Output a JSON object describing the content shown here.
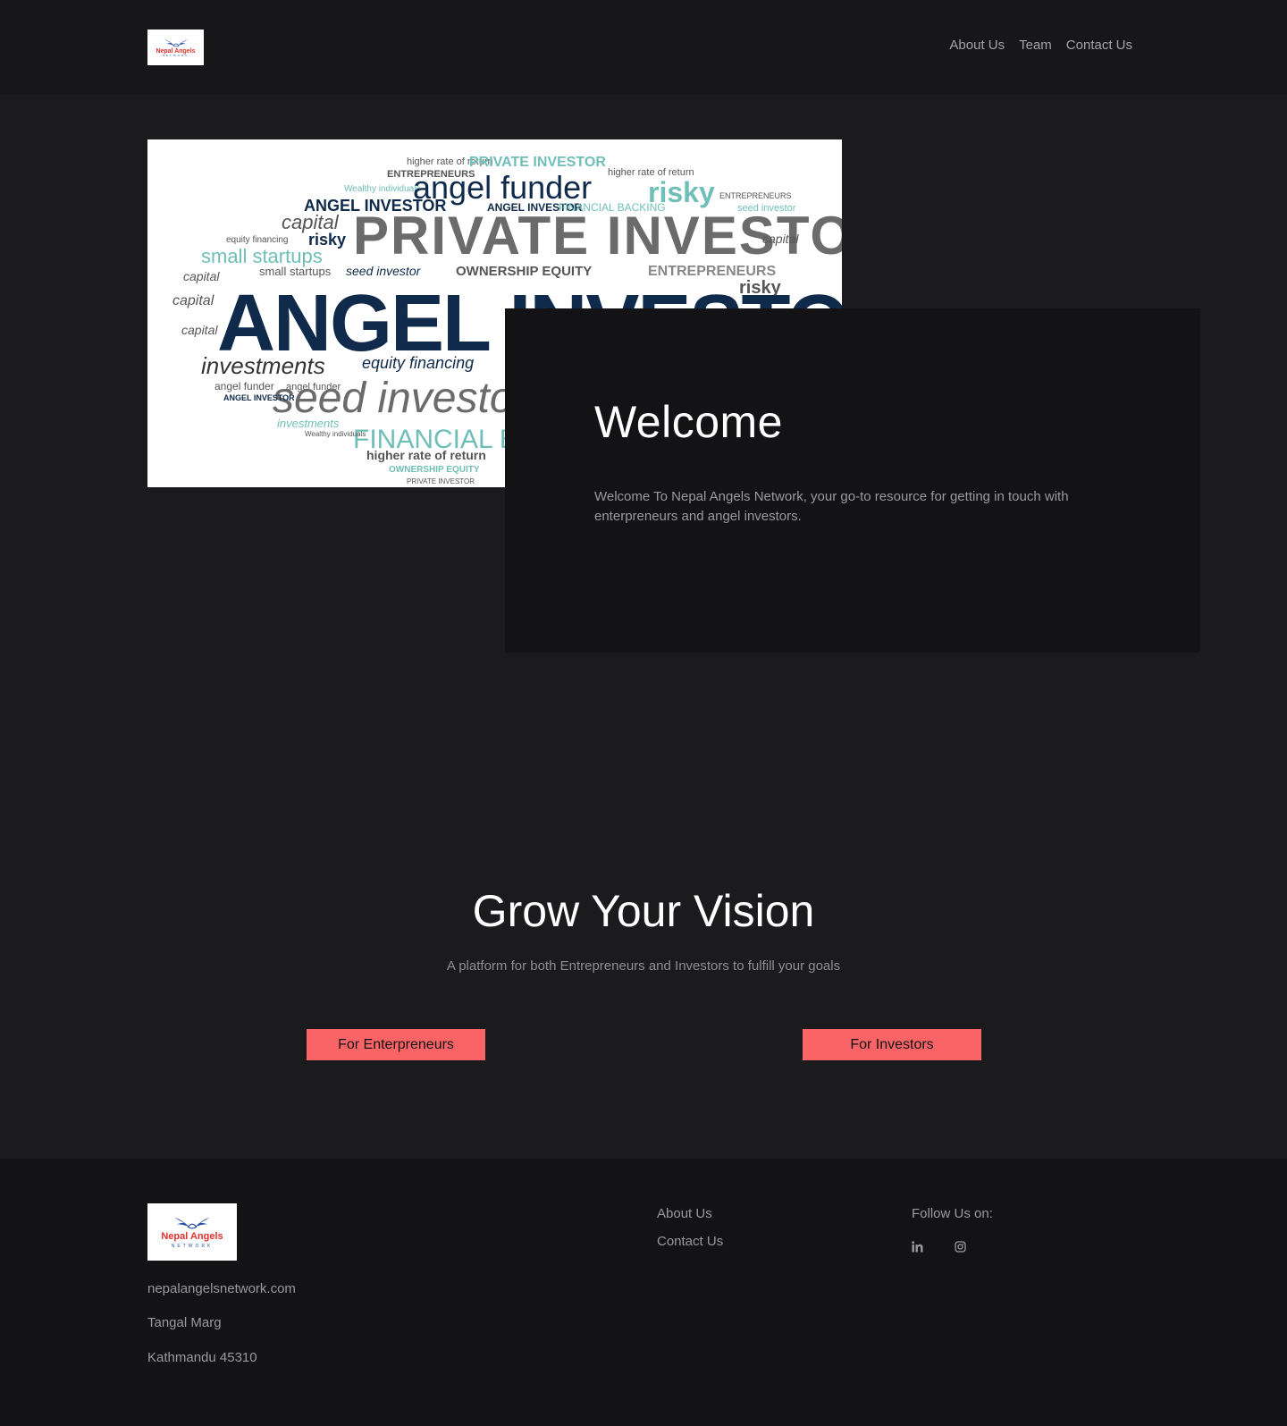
{
  "brand": {
    "logo_name": "Nepal Angels",
    "logo_sub": "NETWORK"
  },
  "nav": {
    "items": [
      "About Us",
      "Team",
      "Contact Us"
    ]
  },
  "hero": {
    "image_words": {
      "headline": "ANGEL INVESTOR",
      "private": "PRIVATE INVESTOR",
      "funder": "angel funder",
      "risky": "risky",
      "seed": "seed investor",
      "investments": "investments",
      "equity": "equity financing",
      "ownership": "OWNERSHIP EQUITY",
      "entrepreneurs": "ENTREPRENEURS",
      "financial": "FINANCIAL BACKING",
      "higher": "higher rate of return",
      "capital": "capital",
      "startups": "small startups",
      "wealthy": "Wealthy individuals"
    },
    "welcome_title": "Welcome",
    "welcome_text": "Welcome To Nepal Angels Network, your go-to resource for getting in touch with enterpreneurs and angel investors."
  },
  "grow": {
    "title": "Grow Your Vision",
    "subtitle": "A platform for both Entrepreneurs and Investors to fulfill your goals",
    "btn_entrepreneurs": "For Enterpreneurs",
    "btn_investors": "For Investors"
  },
  "footer": {
    "site": "nepalangelsnetwork.com",
    "street": "Tangal Marg",
    "city": "Kathmandu 45310",
    "links": [
      "About Us",
      "Contact Us"
    ],
    "follow": "Follow Us on:",
    "social_icons": [
      "linkedin-icon",
      "instagram-icon"
    ]
  },
  "colors": {
    "accent": "#fa6467",
    "background": "#1b1b1d",
    "card": "#131315",
    "navy": "#0f2a4a",
    "teal": "#6fbfb8"
  }
}
